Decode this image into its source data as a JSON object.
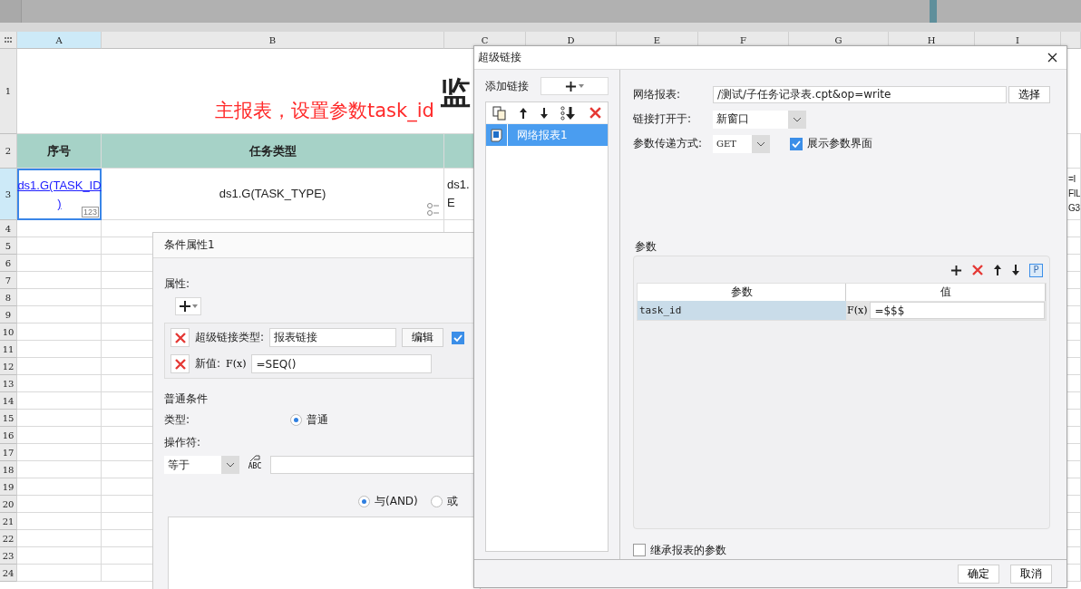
{
  "sheet": {
    "columns": [
      {
        "label": "A",
        "selected": true
      },
      {
        "label": "B",
        "selected": false
      },
      {
        "label": "C",
        "selected": false
      },
      {
        "label": "D",
        "selected": false
      },
      {
        "label": "E",
        "selected": false
      },
      {
        "label": "F",
        "selected": false
      },
      {
        "label": "G",
        "selected": false
      },
      {
        "label": "H",
        "selected": false
      },
      {
        "label": "I",
        "selected": false
      }
    ],
    "rows": [
      {
        "label": "1",
        "selected": false
      },
      {
        "label": "2",
        "selected": false
      },
      {
        "label": "3",
        "selected": true
      },
      {
        "label": "4",
        "selected": false
      },
      {
        "label": "5",
        "selected": false
      },
      {
        "label": "6",
        "selected": false
      },
      {
        "label": "7",
        "selected": false
      },
      {
        "label": "8",
        "selected": false
      },
      {
        "label": "9",
        "selected": false
      },
      {
        "label": "10",
        "selected": false
      },
      {
        "label": "11",
        "selected": false
      },
      {
        "label": "12",
        "selected": false
      },
      {
        "label": "13",
        "selected": false
      },
      {
        "label": "14",
        "selected": false
      },
      {
        "label": "15",
        "selected": false
      },
      {
        "label": "16",
        "selected": false
      },
      {
        "label": "17",
        "selected": false
      },
      {
        "label": "18",
        "selected": false
      },
      {
        "label": "19",
        "selected": false
      },
      {
        "label": "20",
        "selected": false
      },
      {
        "label": "21",
        "selected": false
      },
      {
        "label": "22",
        "selected": false
      },
      {
        "label": "23",
        "selected": false
      },
      {
        "label": "24",
        "selected": false
      }
    ],
    "title": "监",
    "subtitle": "主报表，设置参数task_id",
    "header_cells": [
      "序号",
      "任务类型"
    ],
    "data_cells": [
      {
        "kind": "link",
        "lines": [
          "ds1.G(TASK_ID",
          ")"
        ],
        "badge": "123",
        "selected": true
      },
      {
        "kind": "plain",
        "lines": [
          "ds1.G(TASK_TYPE)"
        ],
        "selected": false
      },
      {
        "kind": "plain",
        "lines": [
          "ds1.",
          "E"
        ],
        "selected": false
      }
    ],
    "overflow_lines": [
      "=I",
      "FIL",
      "G3"
    ]
  },
  "condition_dialog": {
    "title": "条件属性1",
    "attributes_label": "属性:",
    "properties": [
      {
        "kind": "link_type",
        "label": "超级链接类型:",
        "value": "报表链接",
        "button": "编辑"
      },
      {
        "kind": "formula",
        "label": "新值:",
        "formula": "F(x)",
        "value": "=SEQ()"
      }
    ],
    "link_checkbox": {
      "checked": true
    },
    "group_label": "普通条件",
    "type_label": "类型:",
    "type_options": [
      {
        "label": "普通",
        "selected": true
      }
    ],
    "operator_label": "操作符:",
    "operator": "等于",
    "value_type": "ABC",
    "logic_options": [
      {
        "label": "与(AND)",
        "selected": true
      },
      {
        "label": "或",
        "selected": false
      }
    ]
  },
  "link_dialog": {
    "title": "超级链接",
    "add_label": "添加链接",
    "links": [
      {
        "label": "网络报表1",
        "selected": true
      }
    ],
    "report_label": "网络报表:",
    "report_path": "/测试/子任务记录表.cpt&op=write",
    "choose_button": "选择",
    "open_label": "链接打开于:",
    "open_value": "新窗口",
    "method_label": "参数传递方式:",
    "method_value": "GET",
    "show_params": {
      "label": "展示参数界面",
      "checked": true
    },
    "params_label": "参数",
    "params_toolbar_p": "P",
    "params_columns": [
      "参数",
      "值"
    ],
    "params": [
      {
        "name": "task_id",
        "formula": "F(x)",
        "value": "=$$$",
        "selected": true
      }
    ],
    "inherit": {
      "label": "继承报表的参数",
      "checked": false
    },
    "buttons": [
      "确定",
      "取消"
    ]
  }
}
